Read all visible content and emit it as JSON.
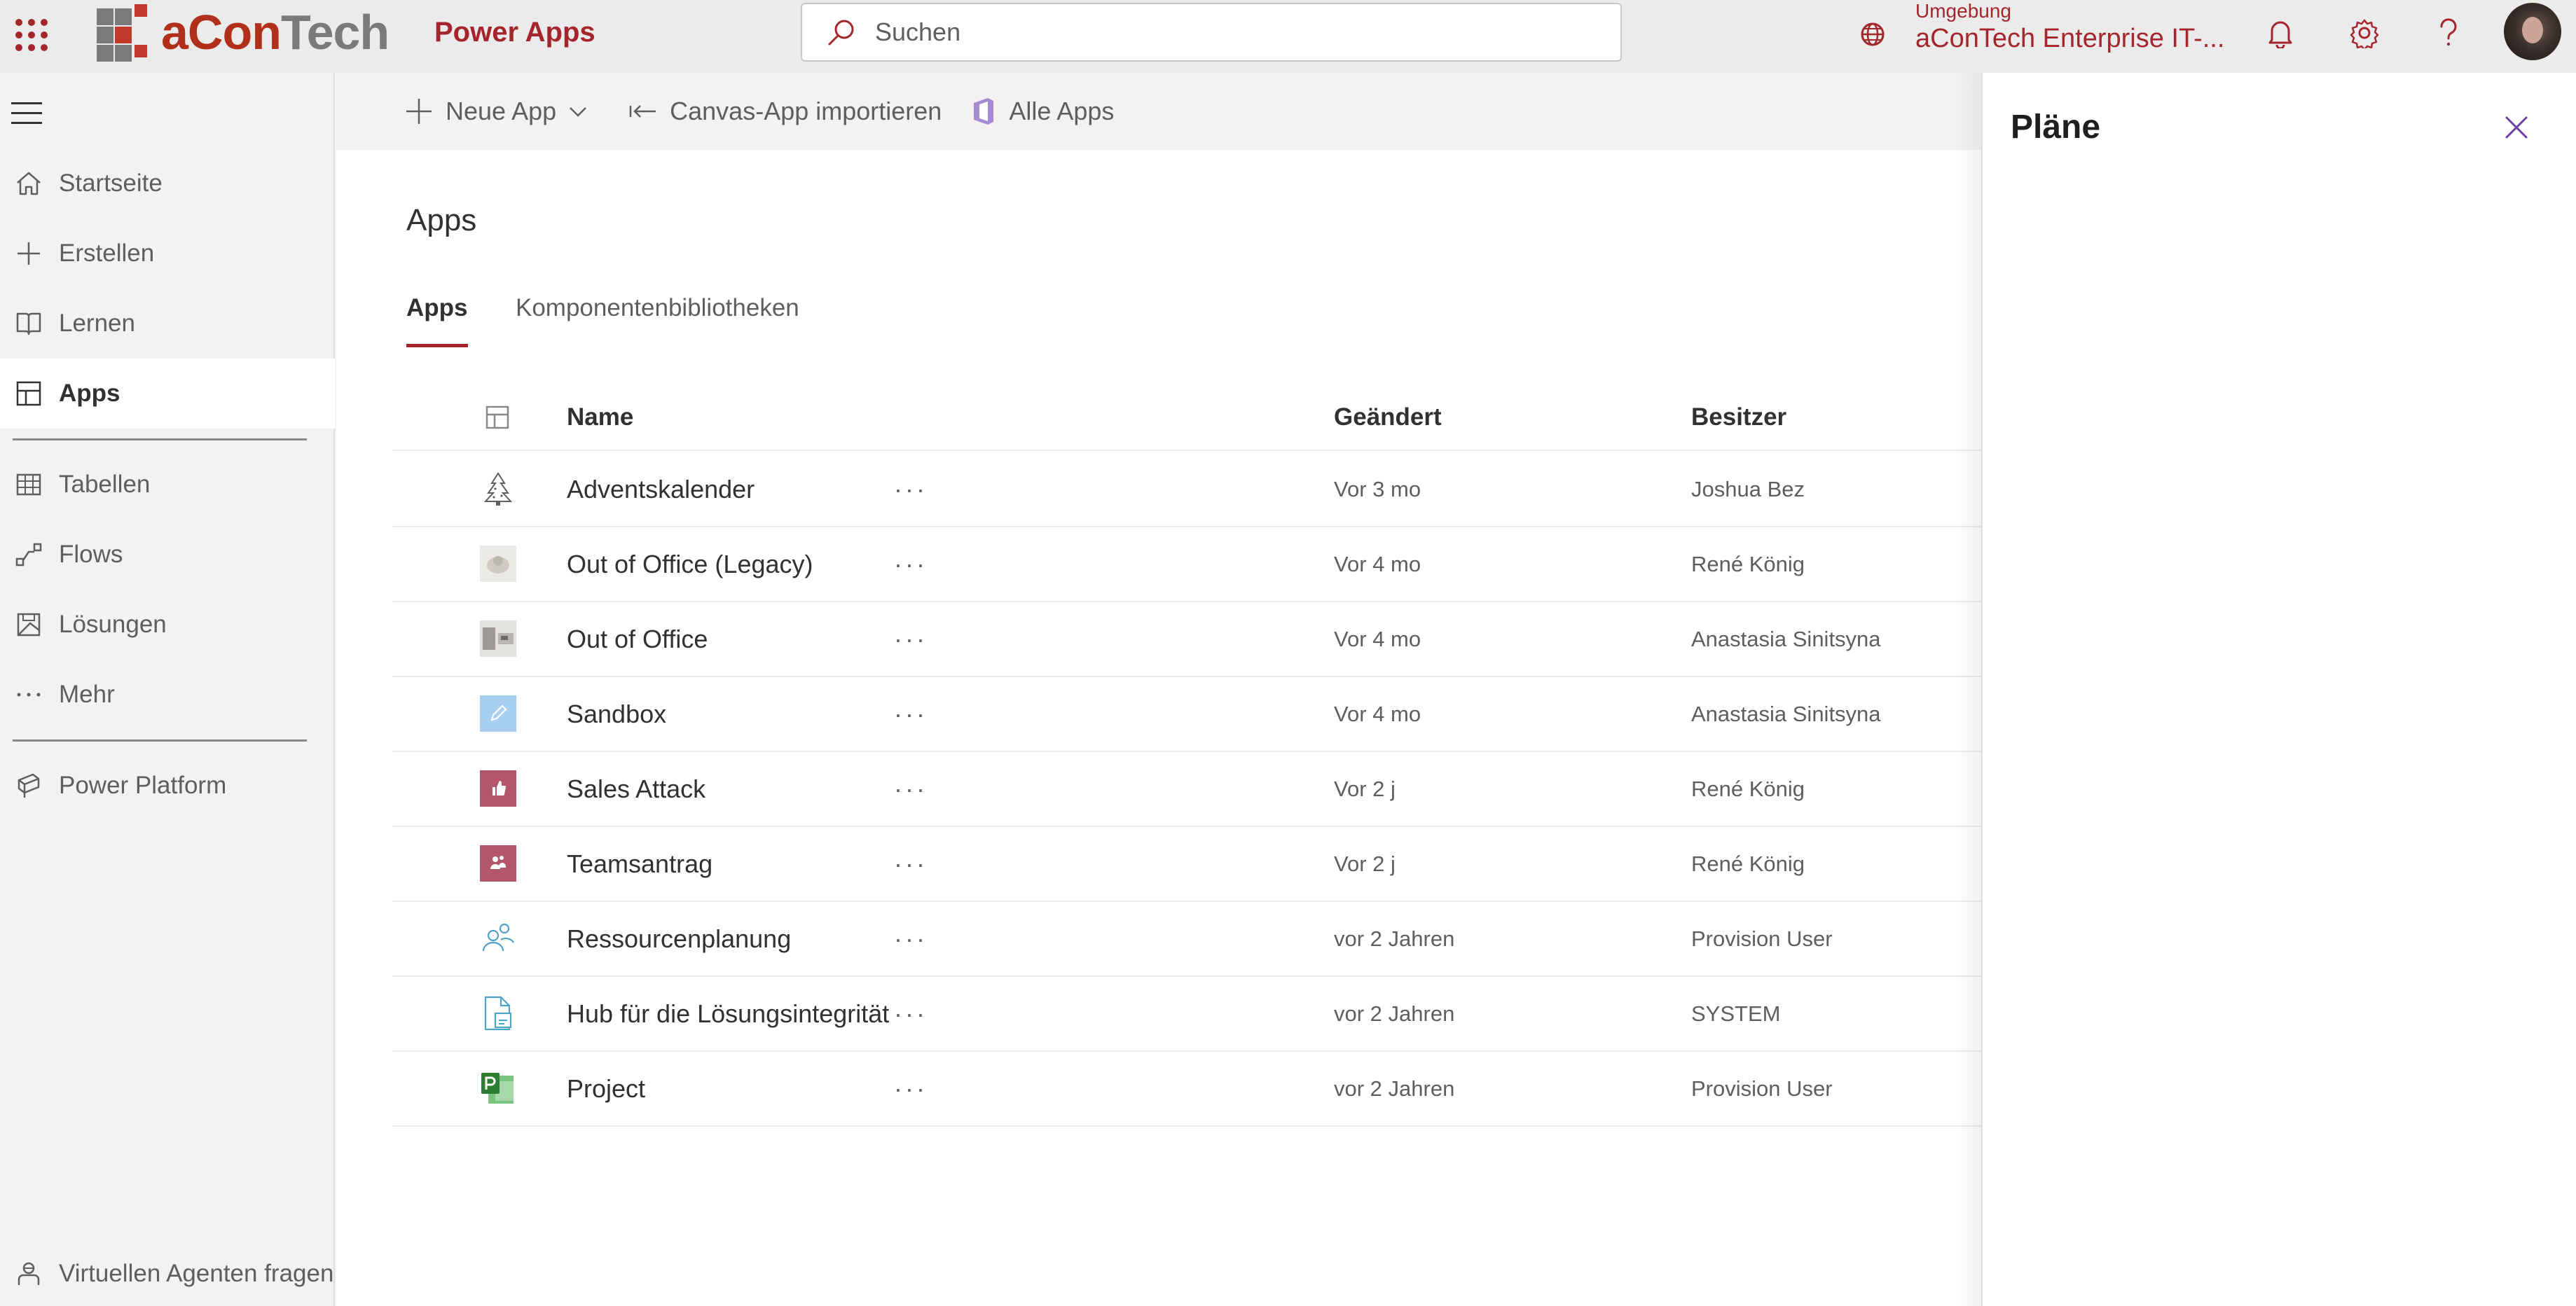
{
  "header": {
    "app_name": "Power Apps",
    "brand_name": "aConTech",
    "search_placeholder": "Suchen",
    "environment_label": "Umgebung",
    "environment_value": "aConTech Enterprise IT-...",
    "icons": [
      "waffle-icon",
      "search-icon",
      "environment-icon",
      "bell-icon",
      "gear-icon",
      "help-icon"
    ],
    "accent_color": "#a4262c"
  },
  "sidebar": {
    "items": [
      {
        "label": "Startseite",
        "icon": "home-icon"
      },
      {
        "label": "Erstellen",
        "icon": "plus-icon"
      },
      {
        "label": "Lernen",
        "icon": "book-icon"
      },
      {
        "label": "Apps",
        "icon": "apps-icon",
        "active": true
      },
      {
        "label": "Tabellen",
        "icon": "table-icon"
      },
      {
        "label": "Flows",
        "icon": "flow-icon"
      },
      {
        "label": "Lösungen",
        "icon": "solutions-icon"
      },
      {
        "label": "Mehr",
        "icon": "more-icon"
      },
      {
        "label": "Power Platform",
        "icon": "power-platform-icon"
      }
    ],
    "agent_label": "Virtuellen Agenten fragen"
  },
  "commands": {
    "new_app": "Neue App",
    "import_canvas": "Canvas-App importieren",
    "all_apps": "Alle Apps"
  },
  "main": {
    "title": "Apps",
    "tabs": [
      "Apps",
      "Komponentenbibliotheken"
    ],
    "columns": {
      "name": "Name",
      "modified": "Geändert",
      "owner": "Besitzer"
    },
    "rows": [
      {
        "name": "Adventskalender",
        "modified": "Vor 3 mo",
        "owner": "Joshua Bez",
        "icon": "tree-icon"
      },
      {
        "name": "Out of Office (Legacy)",
        "modified": "Vor 4 mo",
        "owner": "René König",
        "icon": "image-thumbnail-icon"
      },
      {
        "name": "Out of Office",
        "modified": "Vor 4 mo",
        "owner": "Anastasia Sinitsyna",
        "icon": "image-thumbnail-icon"
      },
      {
        "name": "Sandbox",
        "modified": "Vor 4 mo",
        "owner": "Anastasia Sinitsyna",
        "icon": "pencil-app-icon"
      },
      {
        "name": "Sales Attack",
        "modified": "Vor 2 j",
        "owner": "René König",
        "icon": "thumbs-up-app-icon"
      },
      {
        "name": "Teamsantrag",
        "modified": "Vor 2 j",
        "owner": "René König",
        "icon": "teams-app-icon"
      },
      {
        "name": "Ressourcenplanung",
        "modified": "vor 2 Jahren",
        "owner": "Provision User",
        "icon": "people-icon"
      },
      {
        "name": "Hub für die Lösungsintegrität",
        "modified": "vor 2 Jahren",
        "owner": "SYSTEM",
        "icon": "document-icon"
      },
      {
        "name": "Project",
        "modified": "vor 2 Jahren",
        "owner": "Provision User",
        "icon": "project-icon"
      }
    ],
    "row_more": "···"
  },
  "panel": {
    "title": "Pläne"
  }
}
